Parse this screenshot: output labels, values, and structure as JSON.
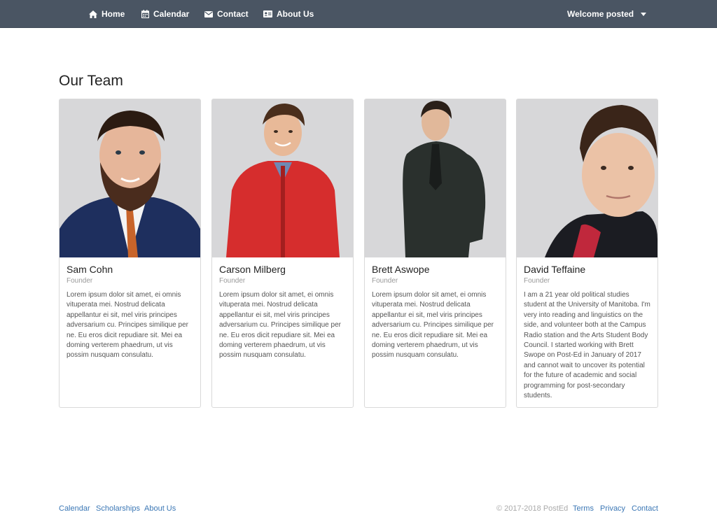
{
  "nav": {
    "home": "Home",
    "calendar": "Calendar",
    "contact": "Contact",
    "about": "About Us",
    "user": "Welcome posted"
  },
  "page_title": "Our Team",
  "team": [
    {
      "name": "Sam Cohn",
      "role": "Founder",
      "bio": "Lorem ipsum dolor sit amet, ei omnis vituperata mei. Nostrud delicata appellantur ei sit, mel viris principes adversarium cu. Principes similique per ne. Eu eros dicit repudiare sit. Mei ea doming verterem phaedrum, ut vis possim nusquam consulatu."
    },
    {
      "name": "Carson Milberg",
      "role": "Founder",
      "bio": "Lorem ipsum dolor sit amet, ei omnis vituperata mei. Nostrud delicata appellantur ei sit, mel viris principes adversarium cu. Principes similique per ne. Eu eros dicit repudiare sit. Mei ea doming verterem phaedrum, ut vis possim nusquam consulatu."
    },
    {
      "name": "Brett Aswope",
      "role": "Founder",
      "bio": "Lorem ipsum dolor sit amet, ei omnis vituperata mei. Nostrud delicata appellantur ei sit, mel viris principes adversarium cu. Principes similique per ne. Eu eros dicit repudiare sit. Mei ea doming verterem phaedrum, ut vis possim nusquam consulatu."
    },
    {
      "name": "David Teffaine",
      "role": "Founder",
      "bio": "I am a 21 year old political studies student at the University of Manitoba. I'm very into reading and linguistics on the side, and volunteer both at the Campus Radio station and the Arts Student Body Council. I started working with Brett Swope on Post-Ed in January of 2017 and cannot wait to uncover its potential for the future of academic and social programming for post-secondary students."
    }
  ],
  "footer": {
    "calendar": "Calendar",
    "scholarships": "Scholarships",
    "about": "About Us",
    "copyright": "© 2017-2018 PostEd",
    "terms": "Terms",
    "privacy": "Privacy",
    "contact": "Contact"
  },
  "colors": {
    "navbar": "#4a5563",
    "link": "#3b77b5",
    "photo_bg": "#d7d7d9"
  }
}
